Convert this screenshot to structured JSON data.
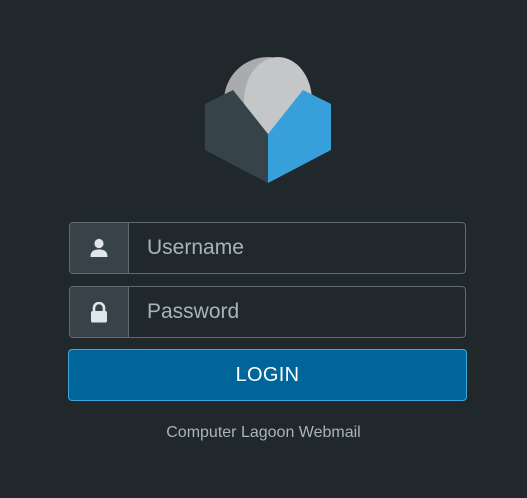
{
  "logo": {
    "icon": "roundcube-logo-icon",
    "colors": {
      "dome": "#bfc1c2",
      "dome_shade": "#a9abac",
      "box_left": "#37434a",
      "box_right": "#37a0da"
    }
  },
  "login_form": {
    "username": {
      "icon": "user-icon",
      "placeholder": "Username",
      "value": ""
    },
    "password": {
      "icon": "lock-icon",
      "placeholder": "Password",
      "value": ""
    },
    "submit_label": "LOGIN"
  },
  "footer": {
    "product_name": "Computer Lagoon Webmail"
  },
  "colors": {
    "background": "#21282c",
    "field_border": "#5d6c73",
    "icon_panel": "#374349",
    "accent": "#006699",
    "accent_border": "#3ea6d9",
    "muted_text": "#a7b4b9"
  }
}
